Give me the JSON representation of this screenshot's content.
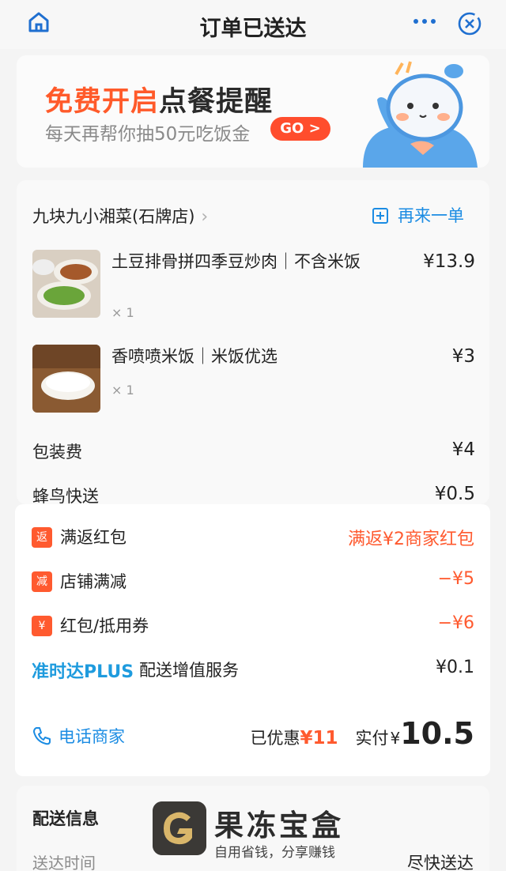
{
  "header": {
    "title": "订单已送达",
    "home_icon": "home-icon",
    "more_icon": "more-icon",
    "close_icon": "close-icon"
  },
  "promo": {
    "headline_accent": "免费开启",
    "headline_main": "点餐提醒",
    "subtitle": "每天再帮你抽50元吃饭金",
    "go_label": "GO >"
  },
  "order": {
    "shop_name": "九块九小湘菜(石牌店)",
    "reorder_label": "再来一单",
    "items": [
      {
        "name": "土豆排骨拼四季豆炒肉｜不含米饭",
        "qty": "× 1",
        "price": "¥13.9"
      },
      {
        "name": "香喷喷米饭｜米饭优选",
        "qty": "× 1",
        "price": "¥3"
      }
    ],
    "fees": [
      {
        "label": "包装费",
        "value": "¥4"
      },
      {
        "label": "蜂鸟快送",
        "value": "¥0.5"
      }
    ]
  },
  "discounts": [
    {
      "tag": "返",
      "label": "满返红包",
      "value": "满返¥2商家红包"
    },
    {
      "tag": "减",
      "label": "店铺满减",
      "value": "−¥5"
    },
    {
      "tag": "¥",
      "label": "红包/抵用券",
      "value": "−¥6"
    }
  ],
  "plus_service": {
    "brand": "准时达PLUS",
    "label": "配送增值服务",
    "value": "¥0.1"
  },
  "footer": {
    "call_label": "电话商家",
    "saved_label": "已优惠",
    "saved_value": "¥11",
    "paid_label": "实付",
    "currency": "¥",
    "paid_value": "10.5"
  },
  "delivery": {
    "title": "配送信息",
    "time_label": "送达时间",
    "time_value": "尽快送达"
  },
  "watermark": {
    "title": "果冻宝盒",
    "subtitle": "自用省钱，分享赚钱"
  },
  "colors": {
    "accent_orange": "#ff5a2f",
    "link_blue": "#1b8ce3",
    "plus_blue": "#1e9bde"
  }
}
